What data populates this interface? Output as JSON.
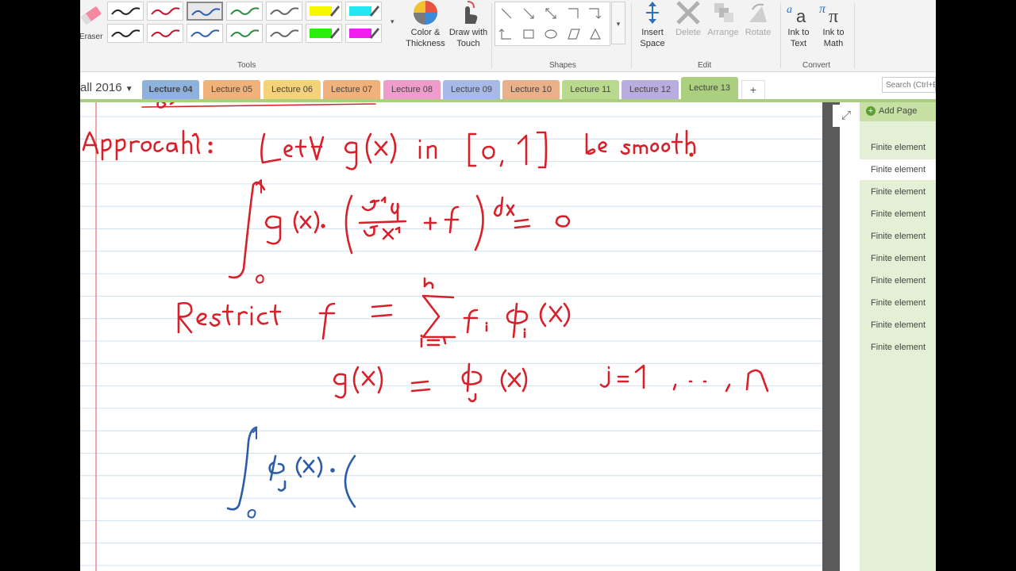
{
  "ribbon": {
    "eraser_label": "Eraser",
    "tools_group": "Tools",
    "shapes_group": "Shapes",
    "edit_group": "Edit",
    "convert_group": "Convert",
    "color_thickness": [
      "Color &",
      "Thickness"
    ],
    "draw_touch": [
      "Draw with",
      "Touch"
    ],
    "insert_space": [
      "Insert",
      "Space"
    ],
    "delete": "Delete",
    "arrange": "Arrange",
    "rotate": "Rotate",
    "ink_to_text": [
      "Ink to",
      "Text"
    ],
    "ink_to_math": [
      "Ink to",
      "Math"
    ],
    "pen_colors": [
      "#222222",
      "#c8102e",
      "#3060b0",
      "#2e8b3e",
      "#666666",
      "#f7f700",
      "#22e6f0",
      "#222222",
      "#c8102e",
      "#3060b0",
      "#2e8b3e",
      "#666666",
      "#29f00a",
      "#f01ff0"
    ]
  },
  "notebook": {
    "title": "all 2016",
    "search_placeholder": "Search (Ctrl+E)",
    "tabs": [
      {
        "label": "Lecture 04",
        "color": "#8fb2dc"
      },
      {
        "label": "Lecture 05",
        "color": "#f0b27a"
      },
      {
        "label": "Lecture 06",
        "color": "#f3d27a"
      },
      {
        "label": "Lecture 07",
        "color": "#f0b27a"
      },
      {
        "label": "Lecture 08",
        "color": "#ee9ccc"
      },
      {
        "label": "Lecture 09",
        "color": "#a7b9e6"
      },
      {
        "label": "Lecture 10",
        "color": "#e9b08a"
      },
      {
        "label": "Lecture 11",
        "color": "#b9d98e"
      },
      {
        "label": "Lecture 12",
        "color": "#b8addf"
      },
      {
        "label": "Lecture 13",
        "color": "#a9cf7f"
      }
    ],
    "add_tab": "+"
  },
  "pages_pane": {
    "add_page": "Add Page",
    "items": [
      "Finite element",
      "Finite element",
      "Finite element",
      "Finite element",
      "Finite element",
      "Finite element",
      "Finite element",
      "Finite element",
      "Finite element",
      "Finite element"
    ],
    "selected_index": 1
  },
  "ink": {
    "red_color": "#d8202a",
    "blue_color": "#2d5ca8",
    "line_approach": "Approach 1:  Let ∀ g(x)  in [0, 1]  be smooth.",
    "line_integral": "∫₀¹ g(x)·( ∂²u/∂x² + f ) dx = 0",
    "line_restrict": "Restrict  f = Σᵢ₌₁ⁿ fᵢ φᵢ(x)",
    "line_g": "g(x) = φⱼ(x)    j = 1, …, n",
    "line_blue": "∫₀¹ φⱼ(x)·("
  }
}
